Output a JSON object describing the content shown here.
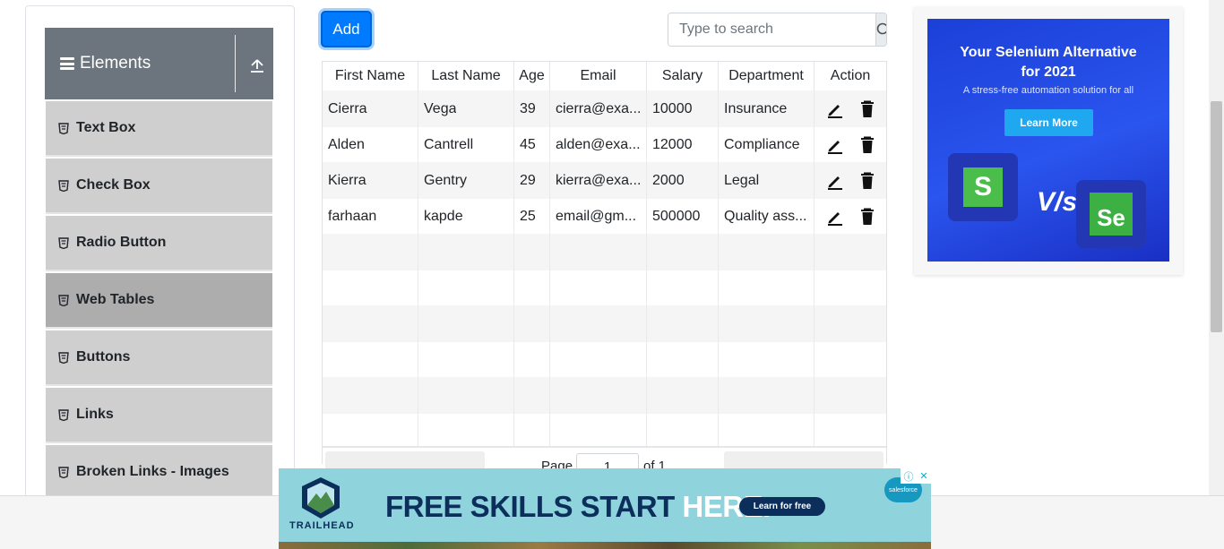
{
  "sidebar": {
    "group_title": "Elements",
    "items": [
      {
        "label": "Text Box",
        "active": false
      },
      {
        "label": "Check Box",
        "active": false
      },
      {
        "label": "Radio Button",
        "active": false
      },
      {
        "label": "Web Tables",
        "active": true
      },
      {
        "label": "Buttons",
        "active": false
      },
      {
        "label": "Links",
        "active": false
      },
      {
        "label": "Broken Links - Images",
        "active": false
      }
    ]
  },
  "toolbar": {
    "add_label": "Add",
    "search_placeholder": "Type to search"
  },
  "table": {
    "columns": [
      "First Name",
      "Last Name",
      "Age",
      "Email",
      "Salary",
      "Department",
      "Action"
    ],
    "rows": [
      {
        "first": "Cierra",
        "last": "Vega",
        "age": "39",
        "email": "cierra@exa...",
        "salary": "10000",
        "dept": "Insurance"
      },
      {
        "first": "Alden",
        "last": "Cantrell",
        "age": "45",
        "email": "alden@exa...",
        "salary": "12000",
        "dept": "Compliance"
      },
      {
        "first": "Kierra",
        "last": "Gentry",
        "age": "29",
        "email": "kierra@exa...",
        "salary": "2000",
        "dept": "Legal"
      },
      {
        "first": "farhaan",
        "last": "kapde",
        "age": "25",
        "email": "email@gm...",
        "salary": "500000",
        "dept": "Quality ass..."
      }
    ],
    "empty_rows": 6
  },
  "pagination": {
    "page_label": "Page",
    "page_value": "1",
    "of_label": "of 1"
  },
  "right_ad": {
    "title_line1": "Your Selenium Alternative",
    "title_line2": "for 2021",
    "subtitle": "A stress-free automation solution for all",
    "button": "Learn More",
    "vs": "V/s"
  },
  "bottom_ad": {
    "brand": "TRAILHEAD",
    "headline_part1": "FREE SKILLS START",
    "headline_part2": "HERE.",
    "cta": "Learn for free",
    "sponsor": "salesforce"
  },
  "colors": {
    "accent": "#007bff",
    "sidebar_header": "#6c757d",
    "menu_item": "#cfcfcf",
    "menu_item_active": "#adadad",
    "banner_bg": "#8fd3dd",
    "ad_blue": "#2a55ee"
  }
}
